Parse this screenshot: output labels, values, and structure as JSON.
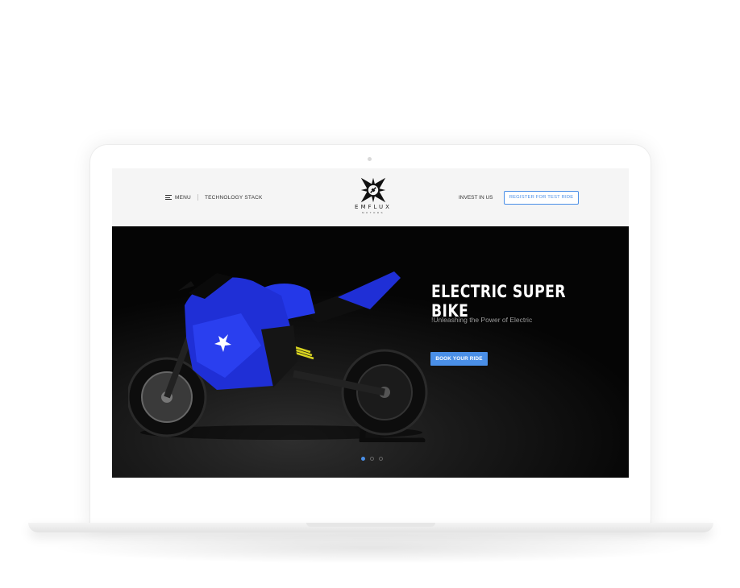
{
  "header": {
    "menu_label": "MENU",
    "technology_label": "TECHNOLOGY STACK",
    "logo_text": "EMFLUX",
    "logo_subtext": "MOTORS",
    "invest_label": "INVEST IN US",
    "test_ride_label": "REGISTER FOR TEST RIDE"
  },
  "hero": {
    "title": "ELECTRIC SUPER BIKE",
    "subtitle": "!Unleashing the Power of Electric",
    "cta_label": "BOOK YOUR RIDE",
    "slides": 3,
    "active_slide": 1
  },
  "colors": {
    "accent": "#4a8fe7",
    "bike_blue": "#1f2fd6",
    "header_bg": "#f5f5f5"
  }
}
